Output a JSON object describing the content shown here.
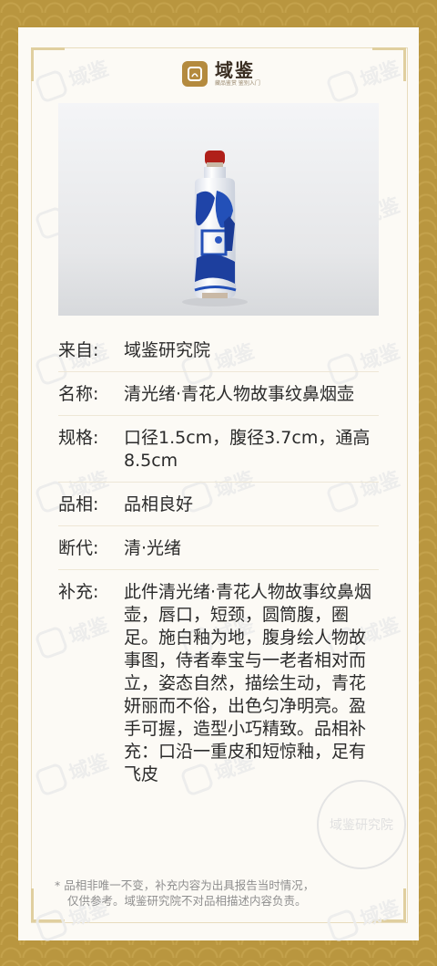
{
  "brand": {
    "name": "域鉴",
    "subtitle": "藏品鉴赏 鉴别入门",
    "icon": "seal-logo-icon",
    "colors": {
      "border": "#b9963f",
      "accent": "#b48a3e",
      "card": "#fcfaf5"
    }
  },
  "photo": {
    "subject": "blue-and-white snuff bottle with red stopper"
  },
  "details": [
    {
      "label": "来自:",
      "value": "域鉴研究院"
    },
    {
      "label": "名称:",
      "value": "清光绪·青花人物故事纹鼻烟壶"
    },
    {
      "label": "规格:",
      "value": "口径1.5cm，腹径3.7cm，通高8.5cm"
    },
    {
      "label": "品相:",
      "value": "品相良好"
    },
    {
      "label": "断代:",
      "value": "清·光绪"
    },
    {
      "label": "补充:",
      "value": "此件清光绪·青花人物故事纹鼻烟壶，唇口，短颈，圆筒腹，圈足。施白釉为地，腹身绘人物故事图，侍者奉宝与一老者相对而立，姿态自然，描绘生动，青花妍丽而不俗，出色匀净明亮。盈手可握，造型小巧精致。品相补充：口沿一重皮和短惊釉，足有飞皮"
    }
  ],
  "footer": {
    "line1": "* 品相非唯一不变，补充内容为出具报告当时情况，",
    "line2": "仅供参考。域鉴研究院不对品相描述内容负责。"
  },
  "watermark_text": "域鉴",
  "seal_text": "域鉴研究院"
}
